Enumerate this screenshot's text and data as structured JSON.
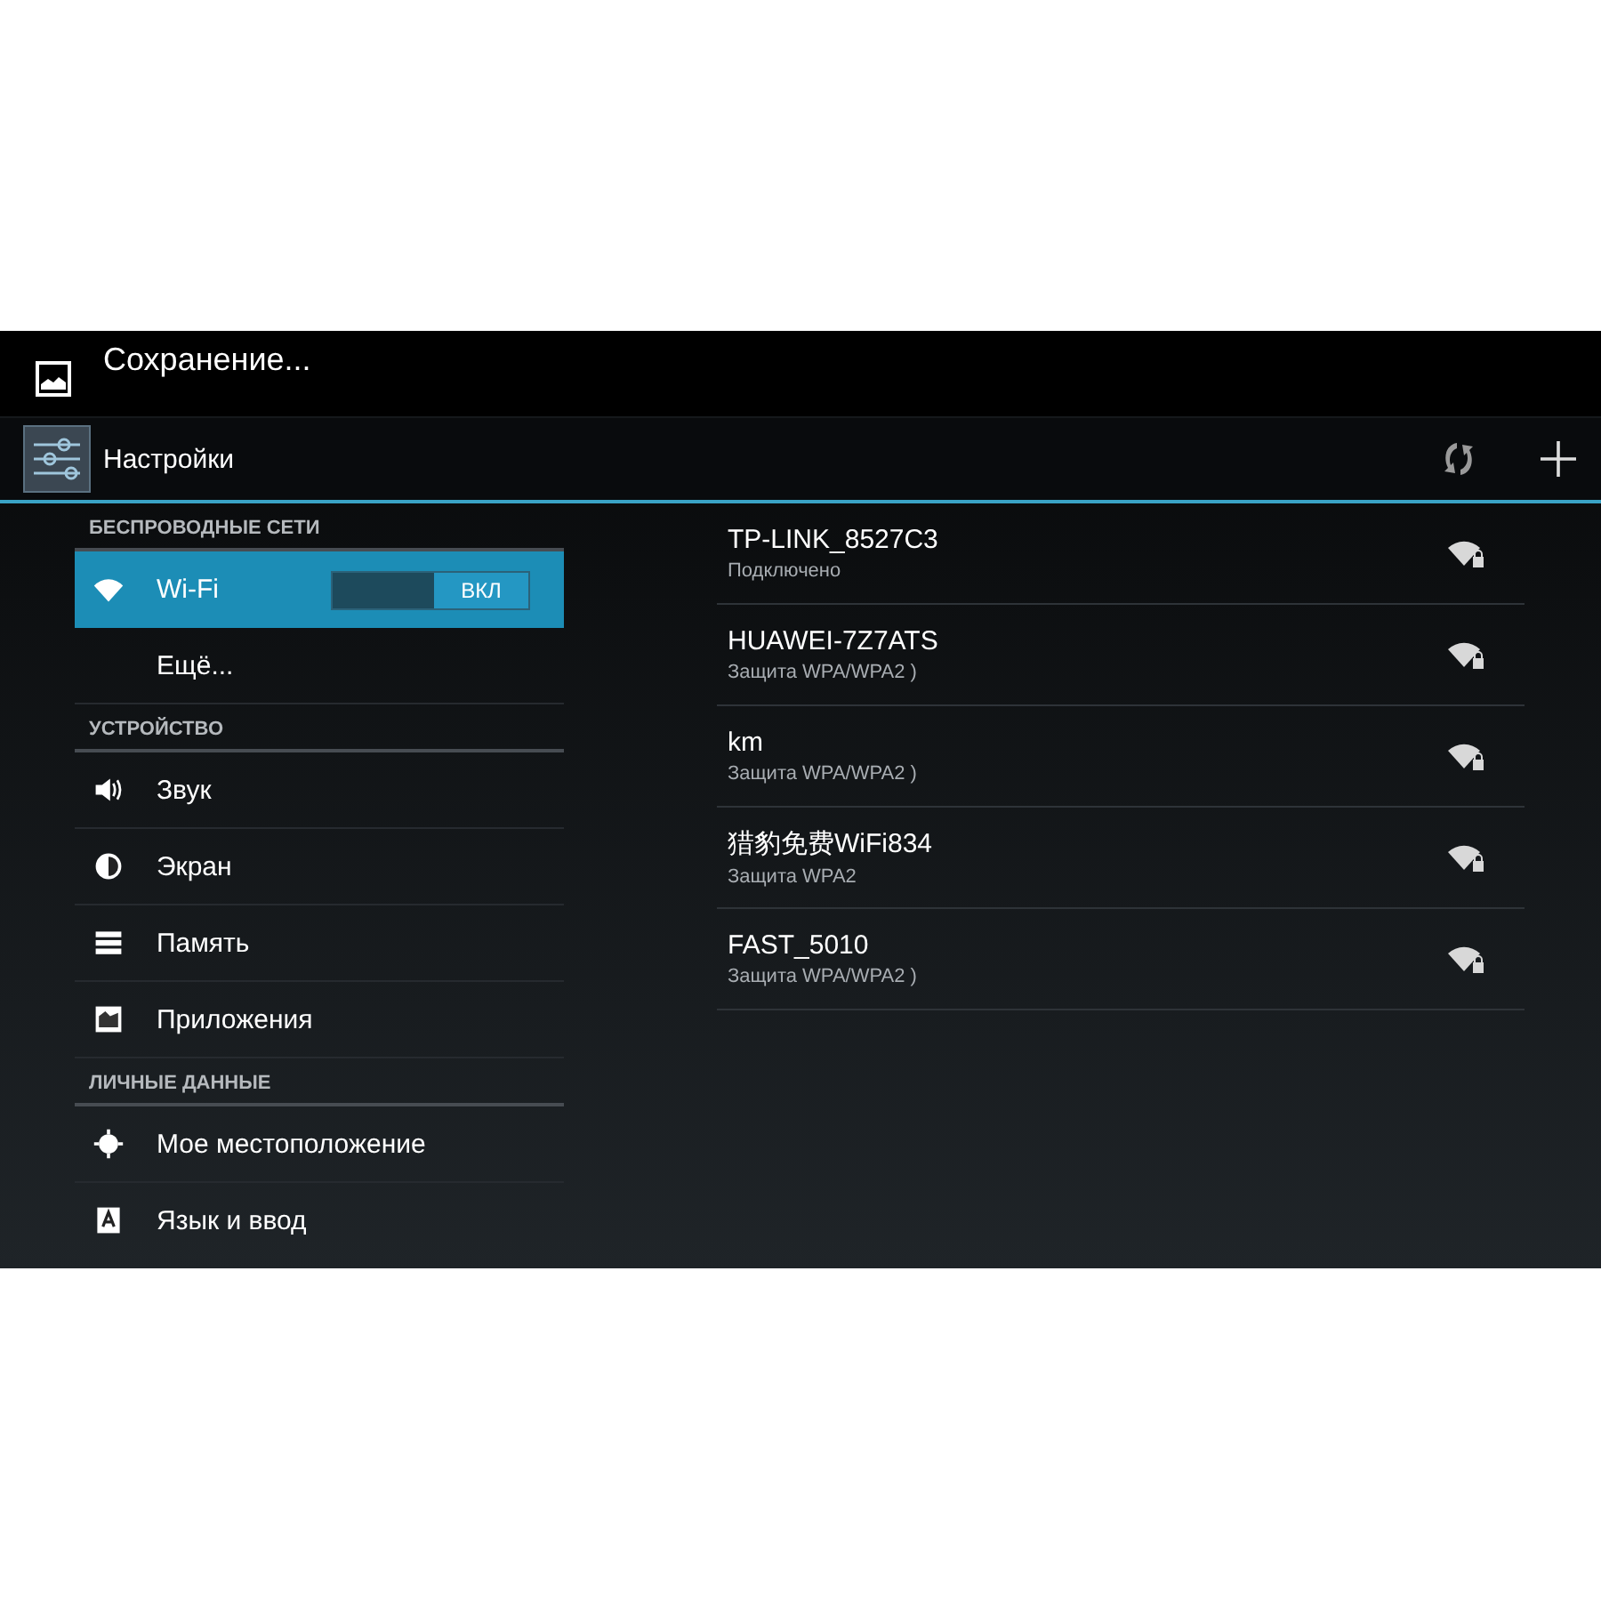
{
  "status_bar": {
    "notification": "Сохранение..."
  },
  "action_bar": {
    "title": "Настройки"
  },
  "sections": [
    {
      "header": "БЕСПРОВОДНЫЕ СЕТИ",
      "items": [
        {
          "label": "Wi-Fi",
          "kind": "wifi",
          "selected": true,
          "switch": {
            "label": "ВКЛ",
            "on": true
          }
        },
        {
          "label": "Ещё...",
          "kind": "plain",
          "selected": false
        }
      ]
    },
    {
      "header": "УСТРОЙСТВО",
      "items": [
        {
          "label": "Звук",
          "kind": "sound",
          "selected": false
        },
        {
          "label": "Экран",
          "kind": "display",
          "selected": false
        },
        {
          "label": "Память",
          "kind": "storage",
          "selected": false
        },
        {
          "label": "Приложения",
          "kind": "apps",
          "selected": false
        }
      ]
    },
    {
      "header": "ЛИЧНЫЕ ДАННЫЕ",
      "items": [
        {
          "label": "Мое местоположение",
          "kind": "location",
          "selected": false
        },
        {
          "label": "Язык и ввод",
          "kind": "language",
          "selected": false
        }
      ]
    }
  ],
  "networks": [
    {
      "name": "TP-LINK_8527C3",
      "status": "Подключено"
    },
    {
      "name": "HUAWEI-7Z7ATS",
      "status": "Защита WPA/WPA2 )"
    },
    {
      "name": "km",
      "status": "Защита WPA/WPA2 )"
    },
    {
      "name": "猎豹免费WiFi834",
      "status": "Защита WPA2"
    },
    {
      "name": "FAST_5010",
      "status": "Защита WPA/WPA2 )"
    }
  ]
}
